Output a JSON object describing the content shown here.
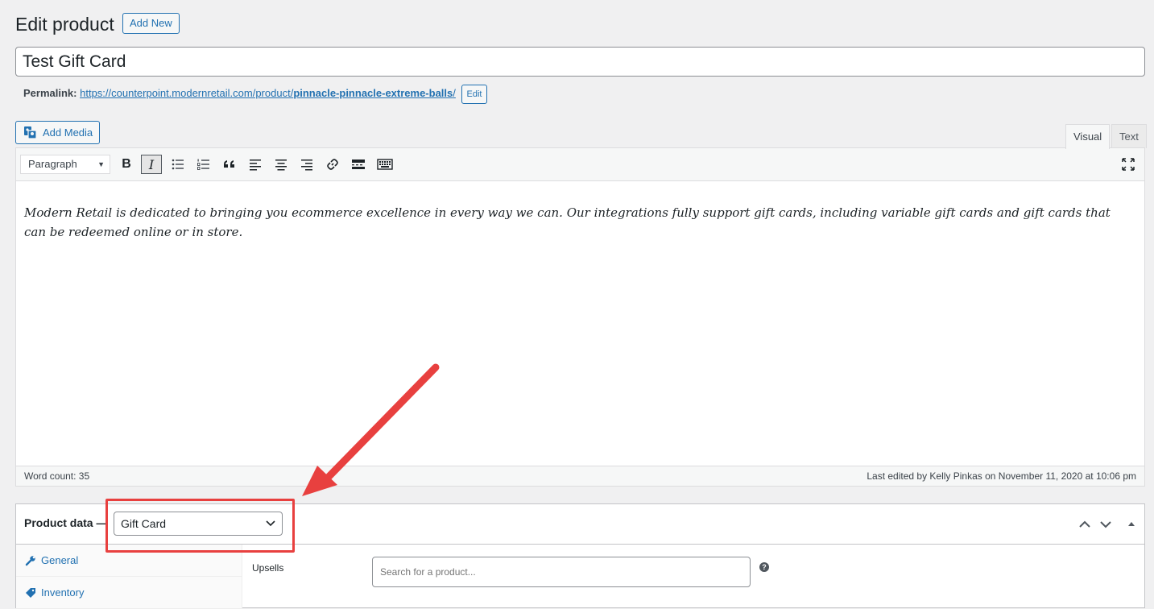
{
  "header": {
    "title": "Edit product",
    "add_new_label": "Add New"
  },
  "post": {
    "title": "Test Gift Card"
  },
  "permalink": {
    "label": "Permalink:",
    "base_url": "https://counterpoint.modernretail.com/product/",
    "slug": "pinnacle-pinnacle-extreme-balls",
    "trailing": "/",
    "edit_label": "Edit"
  },
  "editor": {
    "add_media_label": "Add Media",
    "tabs": {
      "visual": "Visual",
      "text": "Text"
    },
    "format_select": "Paragraph",
    "toolbar_icons": [
      "bold-icon",
      "italic-icon",
      "bullet-list-icon",
      "numbered-list-icon",
      "blockquote-icon",
      "align-left-icon",
      "align-center-icon",
      "align-right-icon",
      "link-icon",
      "read-more-icon",
      "toolbar-toggle-icon",
      "fullscreen-icon"
    ],
    "bold_glyph": "B",
    "italic_glyph": "I",
    "content": "Modern Retail is dedicated to bringing you ecommerce excellence in every way we can. Our integrations fully support gift cards, including variable gift cards and gift cards that can be redeemed online or in store.",
    "word_count": "Word count: 35",
    "last_edited": "Last edited by Kelly Pinkas on November 11, 2020 at 10:06 pm"
  },
  "product_data": {
    "title": "Product data —",
    "type_value": "Gift Card",
    "tabs": [
      {
        "label": "General"
      },
      {
        "label": "Inventory"
      }
    ],
    "upsells_label": "Upsells",
    "upsells_placeholder": "Search for a product...",
    "help_glyph": "?"
  },
  "annotation": {
    "color": "#e8403f"
  }
}
